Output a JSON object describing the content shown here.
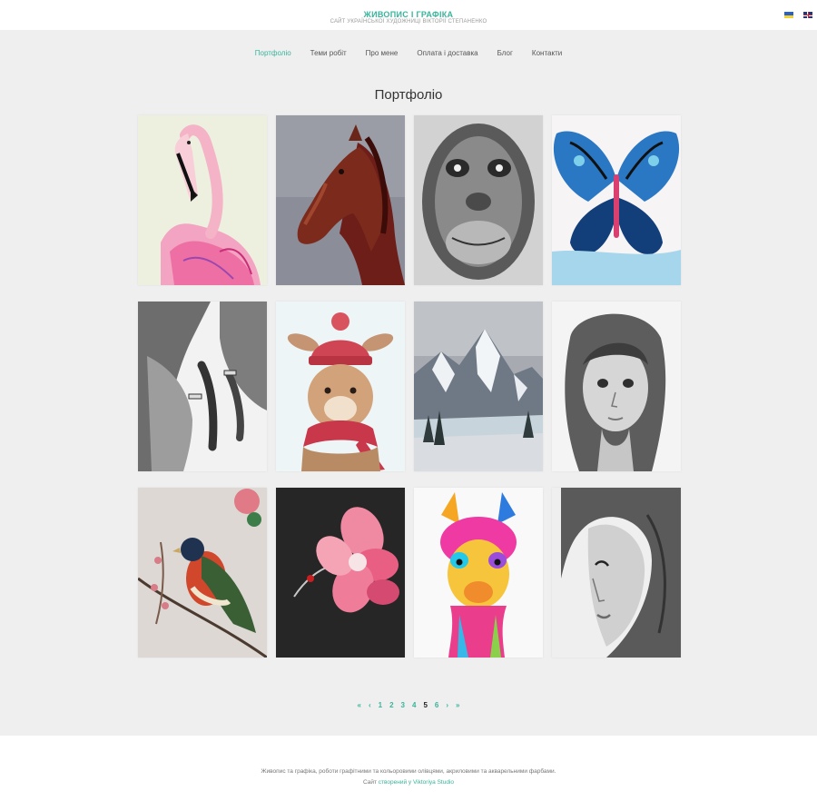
{
  "header": {
    "title": "ЖИВОПИС І ГРАФІКА",
    "subtitle": "САЙТ УКРАЇНСЬКОЇ ХУДОЖНИЦІ ВІКТОРІЇ СТЕПАНЕНКО",
    "languages": [
      {
        "name": "ukrainian-flag-icon",
        "colors": [
          "#2b61c4",
          "#f6d231"
        ]
      },
      {
        "name": "english-flag-icon",
        "colors": [
          "#24357c",
          "#ffffff",
          "#d0242e"
        ]
      }
    ]
  },
  "nav": {
    "items": [
      {
        "label": "Портфоліо",
        "active": true
      },
      {
        "label": "Теми робіт",
        "active": false
      },
      {
        "label": "Про мене",
        "active": false
      },
      {
        "label": "Оплата і доставка",
        "active": false
      },
      {
        "label": "Блог",
        "active": false
      },
      {
        "label": "Контакти",
        "active": false
      }
    ]
  },
  "main": {
    "title": "Портфоліо",
    "gallery": [
      {
        "name": "flamingo-painting"
      },
      {
        "name": "horse-painting"
      },
      {
        "name": "chimpanzee-drawing"
      },
      {
        "name": "butterfly-painting"
      },
      {
        "name": "hands-drawing"
      },
      {
        "name": "bunny-painting"
      },
      {
        "name": "mountain-painting"
      },
      {
        "name": "girl-portrait-drawing"
      },
      {
        "name": "bird-painting"
      },
      {
        "name": "flower-ladybug-painting"
      },
      {
        "name": "llama-painting"
      },
      {
        "name": "woman-portrait-drawing"
      }
    ]
  },
  "pagination": {
    "first": "«",
    "prev": "‹",
    "pages": [
      "1",
      "2",
      "3",
      "4",
      "5",
      "6"
    ],
    "current": "5",
    "next": "›",
    "last": "»"
  },
  "footer": {
    "text": "Живопис та графіка, роботи графітними та кольоровими олівцями, акриловими та акварельними фарбами.",
    "credit_prefix": "Сайт",
    "credit_link": "створений у Viktoriya Studio"
  },
  "colors": {
    "accent": "#37b49c",
    "background": "#efefef",
    "surface": "#ffffff"
  }
}
